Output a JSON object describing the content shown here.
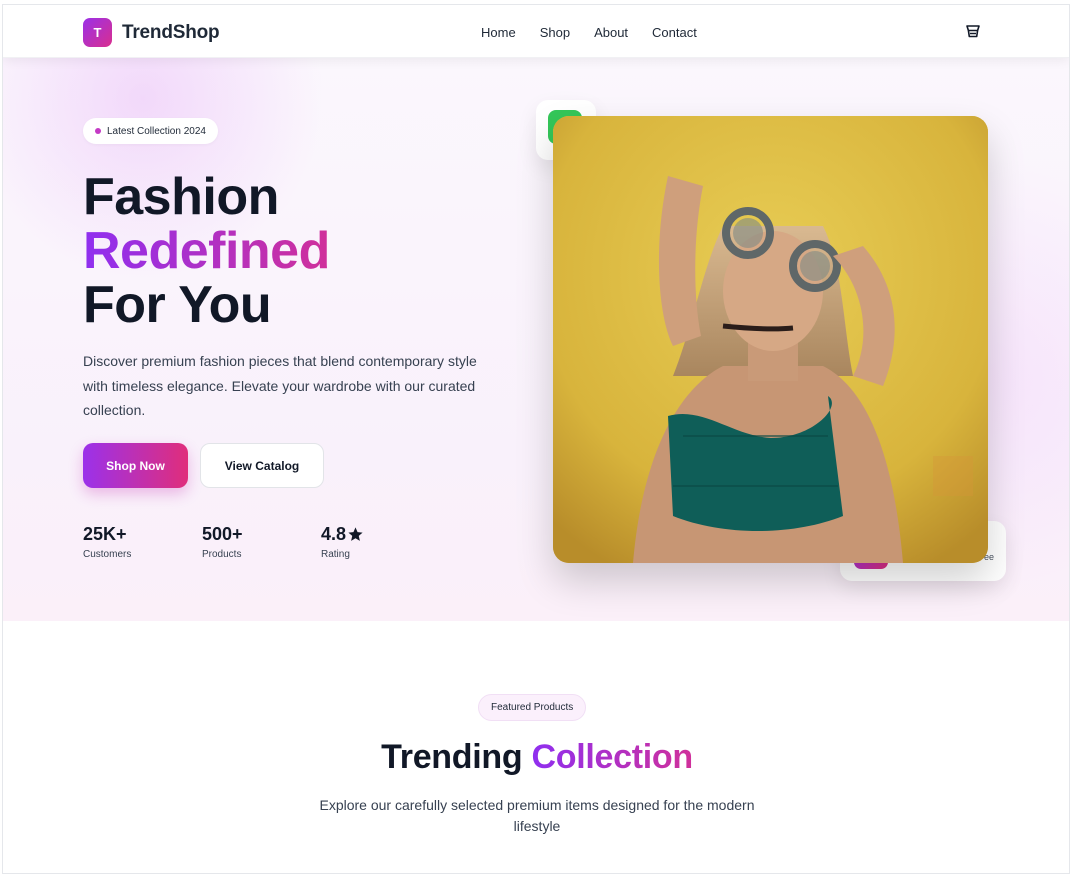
{
  "brand": {
    "logo_letter": "T",
    "name": "TrendShop",
    "accent_start": "#9b31ea",
    "accent_end": "#e02e7b"
  },
  "nav": {
    "items": [
      "Home",
      "Shop",
      "About",
      "Contact"
    ]
  },
  "header": {
    "cart_icon": "shopping-cart-icon"
  },
  "hero": {
    "badge": "Latest Collection 2024",
    "title_line1": "Fashion",
    "title_line2": "Redefined",
    "title_line3": "For You",
    "description": "Discover premium fashion pieces that blend contemporary style with timeless elegance. Elevate your wardrobe with our curated collection.",
    "primary_button": "Shop Now",
    "secondary_button": "View Catalog",
    "stats": [
      {
        "value": "25K+",
        "label": "Customers"
      },
      {
        "value": "500+",
        "label": "Products"
      },
      {
        "value": "4.8",
        "label": "Rating"
      }
    ],
    "float_card_tag": "ee"
  },
  "featured": {
    "pill": "Featured Products",
    "title_part1": "Trending",
    "title_part2": "Collection",
    "subtitle": "Explore our carefully selected premium items designed for the modern lifestyle"
  }
}
